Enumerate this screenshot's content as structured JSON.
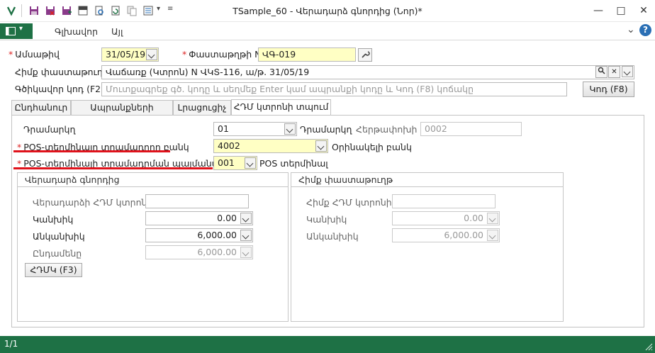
{
  "window": {
    "title": "TSample_60 - Վերադարձ գնորդից (Նոր)*",
    "minimize": "—",
    "maximize": "□",
    "close": "✕"
  },
  "ribbon": {
    "tabs": [
      "Գլխավոր",
      "Այլ"
    ],
    "collapse_glyph": "⌄",
    "help_glyph": "?"
  },
  "form": {
    "date_label": "Ամսաթիվ",
    "date_value": "31/05/19",
    "doc_num_label": "Փաստաթղթի N",
    "doc_num_value": "ՎԳ-019",
    "base_doc_label": "Հիմք փաստաթուղթ",
    "base_doc_value": "Վաճառք (Կտրոն) N ՎԿՏ-116, ա/թ.  31/05/19",
    "barcode_label": "Գծիկավոր կոդ (F2)",
    "barcode_placeholder": "Մուտքագրեք գծ. կոդը և սեղմեք Enter կամ ապրանքի կոդը և Կոդ (F8) կոճակը",
    "code_button": "Կոդ (F8)"
  },
  "tabs": [
    "Ընդհանուր",
    "Ապրանքների ցուցակ",
    "Լրացուցիչ",
    "ՀԴՄ կտրոնի տպում"
  ],
  "active_tab_index": 3,
  "hdm": {
    "cashdesk_label": "Դրամարկղ",
    "cashdesk_value": "01",
    "cashdesk_suffix": "Դրամարկղ",
    "sequence_label": "Հերթափոխի N",
    "sequence_value": "0002",
    "pos_bank_label": "POS-տերմինալը տրամադրող բանկ",
    "pos_bank_value": "4002",
    "pos_bank_suffix": "Օրինակելի բանկ",
    "pos_contract_label": "POS-տերմինալի տրամադրման պայմանագիր",
    "pos_contract_value": "001",
    "pos_contract_suffix": "POS տերմինալ"
  },
  "return_group": {
    "title": "Վերադարձ գնորդից",
    "receipt_label": "Վերադարձի ՀԴՄ կտրոնի N",
    "receipt_value": "",
    "cash_label": "Կանխիկ",
    "cash_value": "0.00",
    "noncash_label": "Անկանխիկ",
    "noncash_value": "6,000.00",
    "total_label": "Ընդամենը",
    "total_value": "6,000.00",
    "hdm_button": "ՀԴՄԿ (F3)"
  },
  "base_group": {
    "title": "Հիմք փաստաթուղթ",
    "receipt_label": "Հիմք ՀԴՄ կտրոնի N",
    "receipt_value": "",
    "cash_label": "Կանխիկ",
    "cash_value": "0.00",
    "noncash_label": "Անկանխիկ",
    "noncash_value": "6,000.00"
  },
  "status": {
    "record": "1/1"
  },
  "colors": {
    "accent_green": "#1e7145",
    "required_red": "#d22222",
    "highlight_yellow": "#ffffc4",
    "annotation_red": "#e0121b"
  }
}
